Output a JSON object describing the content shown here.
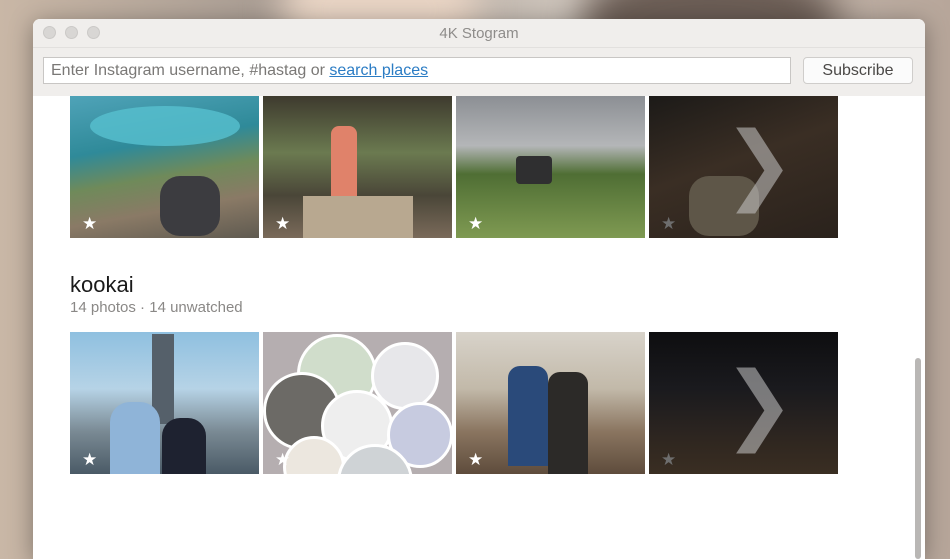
{
  "window": {
    "title": "4K Stogram"
  },
  "toolbar": {
    "search_placeholder": "Enter Instagram username, #hastag or ",
    "search_link": "search places",
    "subscribe_label": "Subscribe"
  },
  "groups": [
    {
      "title": "kookai",
      "photos_count": "14 photos",
      "separator": " · ",
      "unwatched_count": "14 unwatched"
    }
  ],
  "icons": {
    "star": "★",
    "chevron": "❯"
  },
  "colors": {
    "link": "#2b7cc4",
    "window_bg": "#ffffff",
    "toolbar_bg": "#f0eeec"
  }
}
